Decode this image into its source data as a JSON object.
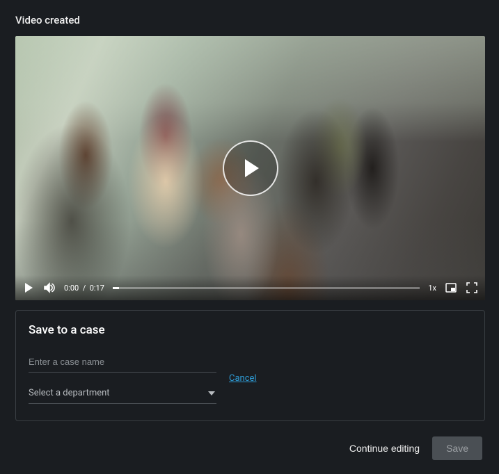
{
  "heading": "Video created",
  "video": {
    "current_time": "0:00",
    "separator": "/",
    "duration": "0:17",
    "speed": "1x"
  },
  "card": {
    "title": "Save to a case",
    "case_name_placeholder": "Enter a case name",
    "case_name_value": "",
    "department_placeholder": "Select a department",
    "cancel_label": "Cancel"
  },
  "footer": {
    "continue_label": "Continue editing",
    "save_label": "Save"
  }
}
